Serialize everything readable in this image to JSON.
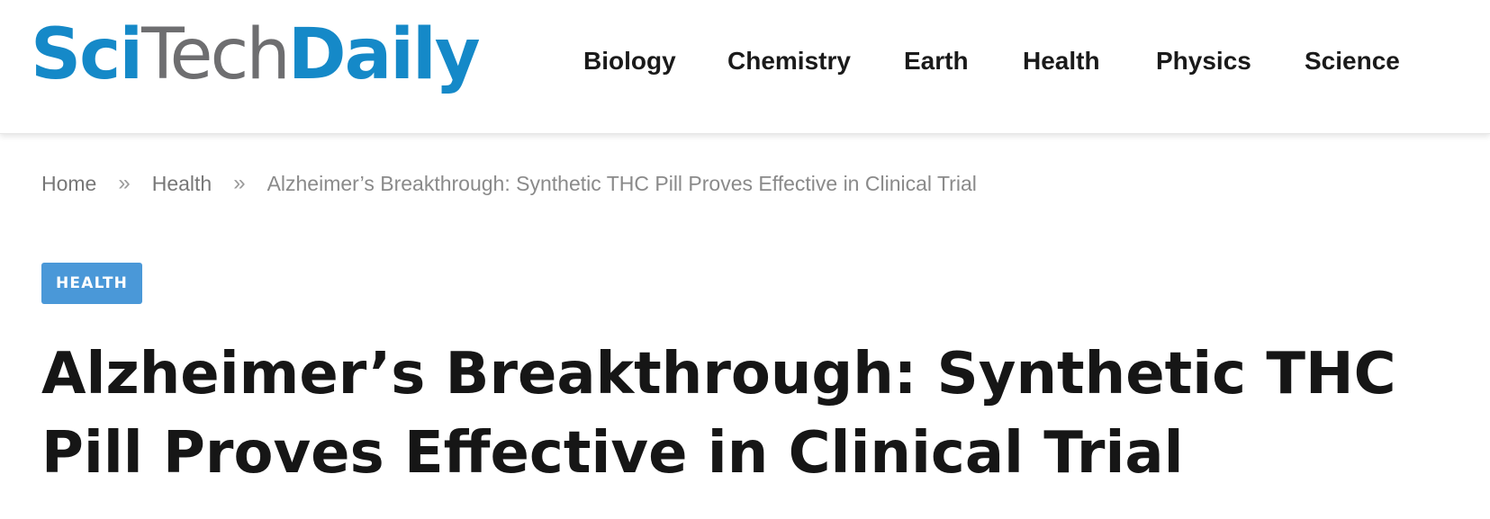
{
  "logo": {
    "part1": "Sci",
    "part2": "Tech",
    "part3": "Daily"
  },
  "nav": {
    "items": [
      "Biology",
      "Chemistry",
      "Earth",
      "Health",
      "Physics",
      "Science"
    ]
  },
  "breadcrumb": {
    "home": "Home",
    "separator": "»",
    "category": "Health",
    "current": "Alzheimer’s Breakthrough: Synthetic THC Pill Proves Effective in Clinical Trial"
  },
  "article": {
    "category_badge": "HEALTH",
    "title": "Alzheimer’s Breakthrough: Synthetic THC Pill Proves Effective in Clinical Trial"
  },
  "colors": {
    "brand_blue": "#1589c8",
    "brand_gray": "#6e6e70",
    "badge_blue": "#4a98d8",
    "title_text": "#161616"
  }
}
